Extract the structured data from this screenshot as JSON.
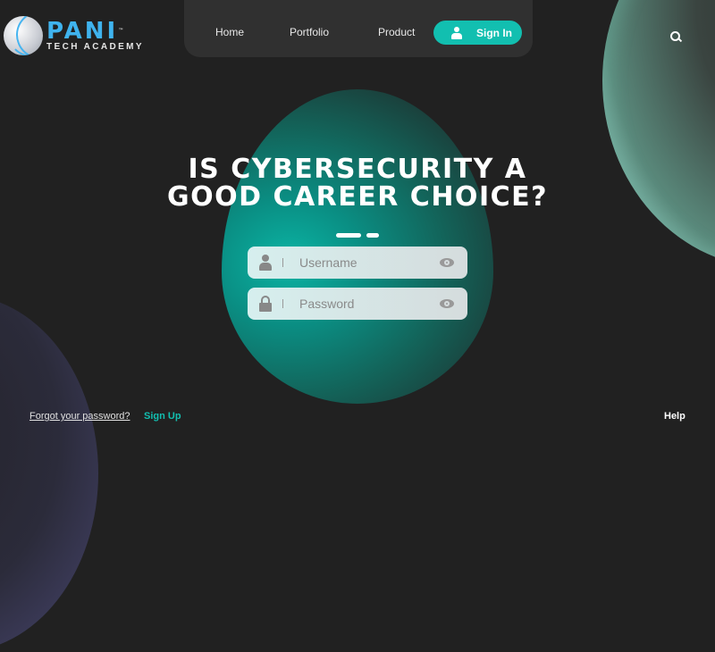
{
  "brand": {
    "name": "PANI",
    "trademark": "™",
    "tagline": "TECH ACADEMY",
    "accent_color": "#3fb3ee"
  },
  "nav": {
    "items": [
      {
        "label": "Home"
      },
      {
        "label": "Portfolio"
      },
      {
        "label": "Product"
      }
    ],
    "sign_in_label": "Sign In",
    "sign_in_color": "#12bfb0"
  },
  "hero": {
    "title_line1": "IS CYBERSECURITY A",
    "title_line2": "GOOD CAREER CHOICE?"
  },
  "form": {
    "username_placeholder": "Username",
    "password_placeholder": "Password"
  },
  "footer": {
    "forgot_password": "Forgot your password?",
    "sign_up": "Sign Up",
    "help": "Help"
  }
}
